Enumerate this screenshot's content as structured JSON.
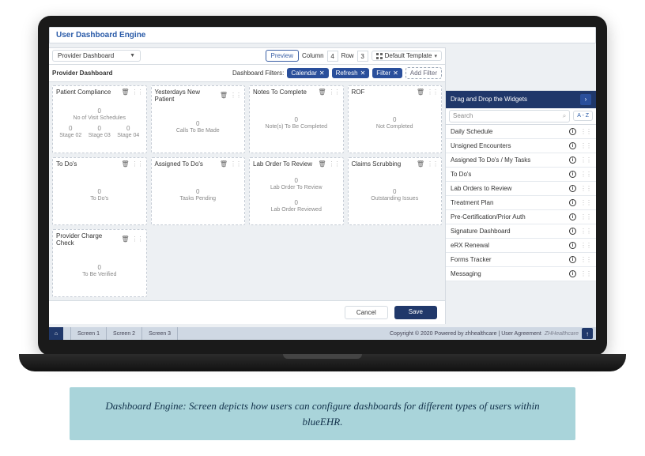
{
  "title": "User Dashboard Engine",
  "dashboard_select": "Provider Dashboard",
  "subheader_title": "Provider Dashboard",
  "controls": {
    "preview": "Preview",
    "column_label": "Column",
    "column_value": "4",
    "row_label": "Row",
    "row_value": "3",
    "template_label": "Default Template"
  },
  "filters": {
    "label": "Dashboard Filters:",
    "chips": [
      "Calendar",
      "Refresh",
      "Filter"
    ],
    "add": "Add Filter"
  },
  "cards": [
    {
      "title": "Patient Compliance",
      "stats": [
        {
          "n": "0",
          "t": "No of Visit Schedules"
        },
        {
          "n": "0",
          "t": "Stage 02"
        },
        {
          "n": "0",
          "t": "Stage 03"
        },
        {
          "n": "0",
          "t": "Stage 04"
        }
      ]
    },
    {
      "title": "Yesterdays New Patient",
      "stats": [
        {
          "n": "0",
          "t": "Calls To Be Made"
        }
      ]
    },
    {
      "title": "Notes To Complete",
      "stats": [
        {
          "n": "0",
          "t": "Note(s) To Be Completed"
        }
      ]
    },
    {
      "title": "ROF",
      "stats": [
        {
          "n": "0",
          "t": "Not Completed"
        }
      ]
    },
    {
      "title": "To Do's",
      "stats": [
        {
          "n": "0",
          "t": "To Do's"
        }
      ]
    },
    {
      "title": "Assigned To Do's",
      "stats": [
        {
          "n": "0",
          "t": "Tasks Pending"
        }
      ]
    },
    {
      "title": "Lab Order To Review",
      "stack": true,
      "stats": [
        {
          "n": "0",
          "t": "Lab Order To Review"
        },
        {
          "n": "0",
          "t": "Lab Order Reviewed"
        }
      ]
    },
    {
      "title": "Claims Scrubbing",
      "stats": [
        {
          "n": "0",
          "t": "Outstanding Issues"
        }
      ]
    },
    {
      "title": "Provider Charge Check",
      "stats": [
        {
          "n": "0",
          "t": "To Be Verified"
        }
      ]
    }
  ],
  "widget_panel": {
    "header": "Drag and Drop the Widgets",
    "search_placeholder": "Search",
    "az": "A - Z",
    "items": [
      "Daily Schedule",
      "Unsigned Encounters",
      "Assigned To Do's / My Tasks",
      "To Do's",
      "Lab Orders to Review",
      "Treatment Plan",
      "Pre-Certification/Prior Auth",
      "Signature Dashboard",
      "eRX Renewal",
      "Forms Tracker",
      "Messaging"
    ]
  },
  "footer": {
    "cancel": "Cancel",
    "save": "Save"
  },
  "status": {
    "tabs": [
      "Screen 1",
      "Screen 2",
      "Screen 3"
    ],
    "right": "Copyright © 2020 Powered by zhhealthcare | User Agreement",
    "brand": "ZHHealthcare"
  },
  "caption": "Dashboard Engine: Screen depicts how users can configure dashboards for different types of users within blueEHR."
}
